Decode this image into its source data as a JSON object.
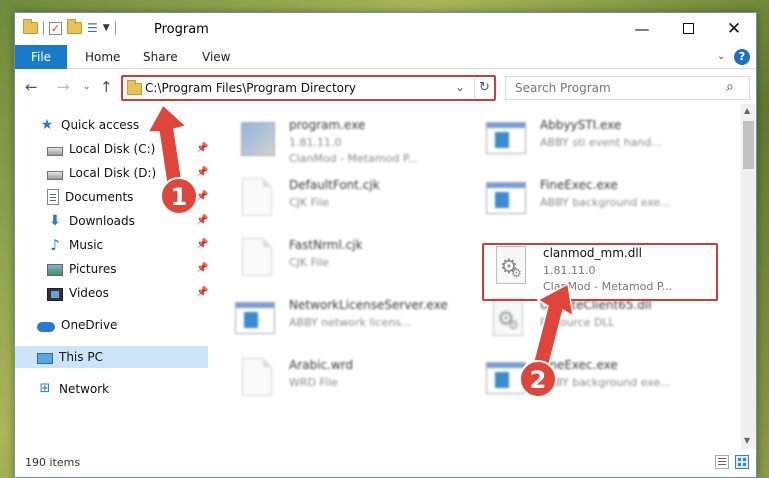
{
  "window": {
    "title": "Program",
    "minimize_label": "—",
    "close_label": "✕"
  },
  "ribbon": {
    "tabs": [
      "File",
      "Home",
      "Share",
      "View"
    ]
  },
  "address": {
    "path": "C:\\Program Files\\Program Directory"
  },
  "search": {
    "placeholder": "Search Program"
  },
  "navpane": {
    "items": [
      {
        "label": "Quick access",
        "icon": "quick-access-star-icon",
        "pinned": false
      },
      {
        "label": "Local Disk (C:)",
        "icon": "drive-icon",
        "pinned": true
      },
      {
        "label": "Local Disk (D:)",
        "icon": "drive-icon",
        "pinned": true
      },
      {
        "label": "Documents",
        "icon": "documents-icon",
        "pinned": true
      },
      {
        "label": "Downloads",
        "icon": "download-icon",
        "pinned": true
      },
      {
        "label": "Music",
        "icon": "music-icon",
        "pinned": true
      },
      {
        "label": "Pictures",
        "icon": "pictures-icon",
        "pinned": true
      },
      {
        "label": "Videos",
        "icon": "videos-icon",
        "pinned": true
      },
      {
        "label": "OneDrive",
        "icon": "onedrive-cloud-icon",
        "pinned": false
      },
      {
        "label": "This PC",
        "icon": "this-pc-icon",
        "pinned": false,
        "selected": true
      },
      {
        "label": "Network",
        "icon": "network-icon",
        "pinned": false
      }
    ]
  },
  "files": [
    {
      "name": "program.exe",
      "line1": "1.81.11.0",
      "line2": "ClanMod - Metamod P...",
      "icon": "app-icon"
    },
    {
      "name": "AbbyySTI.exe",
      "line1": "ABBY sti event hand...",
      "line2": "",
      "icon": "exe-window-icon"
    },
    {
      "name": "DefaultFont.cjk",
      "line1": "CJK File",
      "line2": "",
      "icon": "document-icon"
    },
    {
      "name": "FineExec.exe",
      "line1": "ABBY background exe...",
      "line2": "",
      "icon": "exe-window-icon"
    },
    {
      "name": "FastNrml.cjk",
      "line1": "CJK File",
      "line2": "",
      "icon": "document-icon"
    },
    {
      "name": "clanmod_mm.dll",
      "line1": "1.81.11.0",
      "line2": "ClanMod - Metamod P...",
      "icon": "dll-gear-icon"
    },
    {
      "name": "NetworkLicenseServer.exe",
      "line1": "ABBY network licens...",
      "line2": "",
      "icon": "exe-window-icon"
    },
    {
      "name": "UpdateClient65.dll",
      "line1": "Resource DLL",
      "line2": "",
      "icon": "dll-gear-icon"
    },
    {
      "name": "Arabic.wrd",
      "line1": "WRD File",
      "line2": "",
      "icon": "document-icon"
    },
    {
      "name": "FineExec.exe",
      "line1": "ABBY background exe...",
      "line2": "",
      "icon": "exe-window-icon"
    }
  ],
  "status": {
    "item_count": "190 items"
  },
  "annotations": [
    {
      "number": "1",
      "target": "address-bar"
    },
    {
      "number": "2",
      "target": "clanmod_mm.dll"
    }
  ],
  "colors": {
    "accent": "#1979ca",
    "highlight_red": "#d23b3b",
    "badge_red": "#e0453a",
    "selected_nav": "#cce4f7"
  }
}
